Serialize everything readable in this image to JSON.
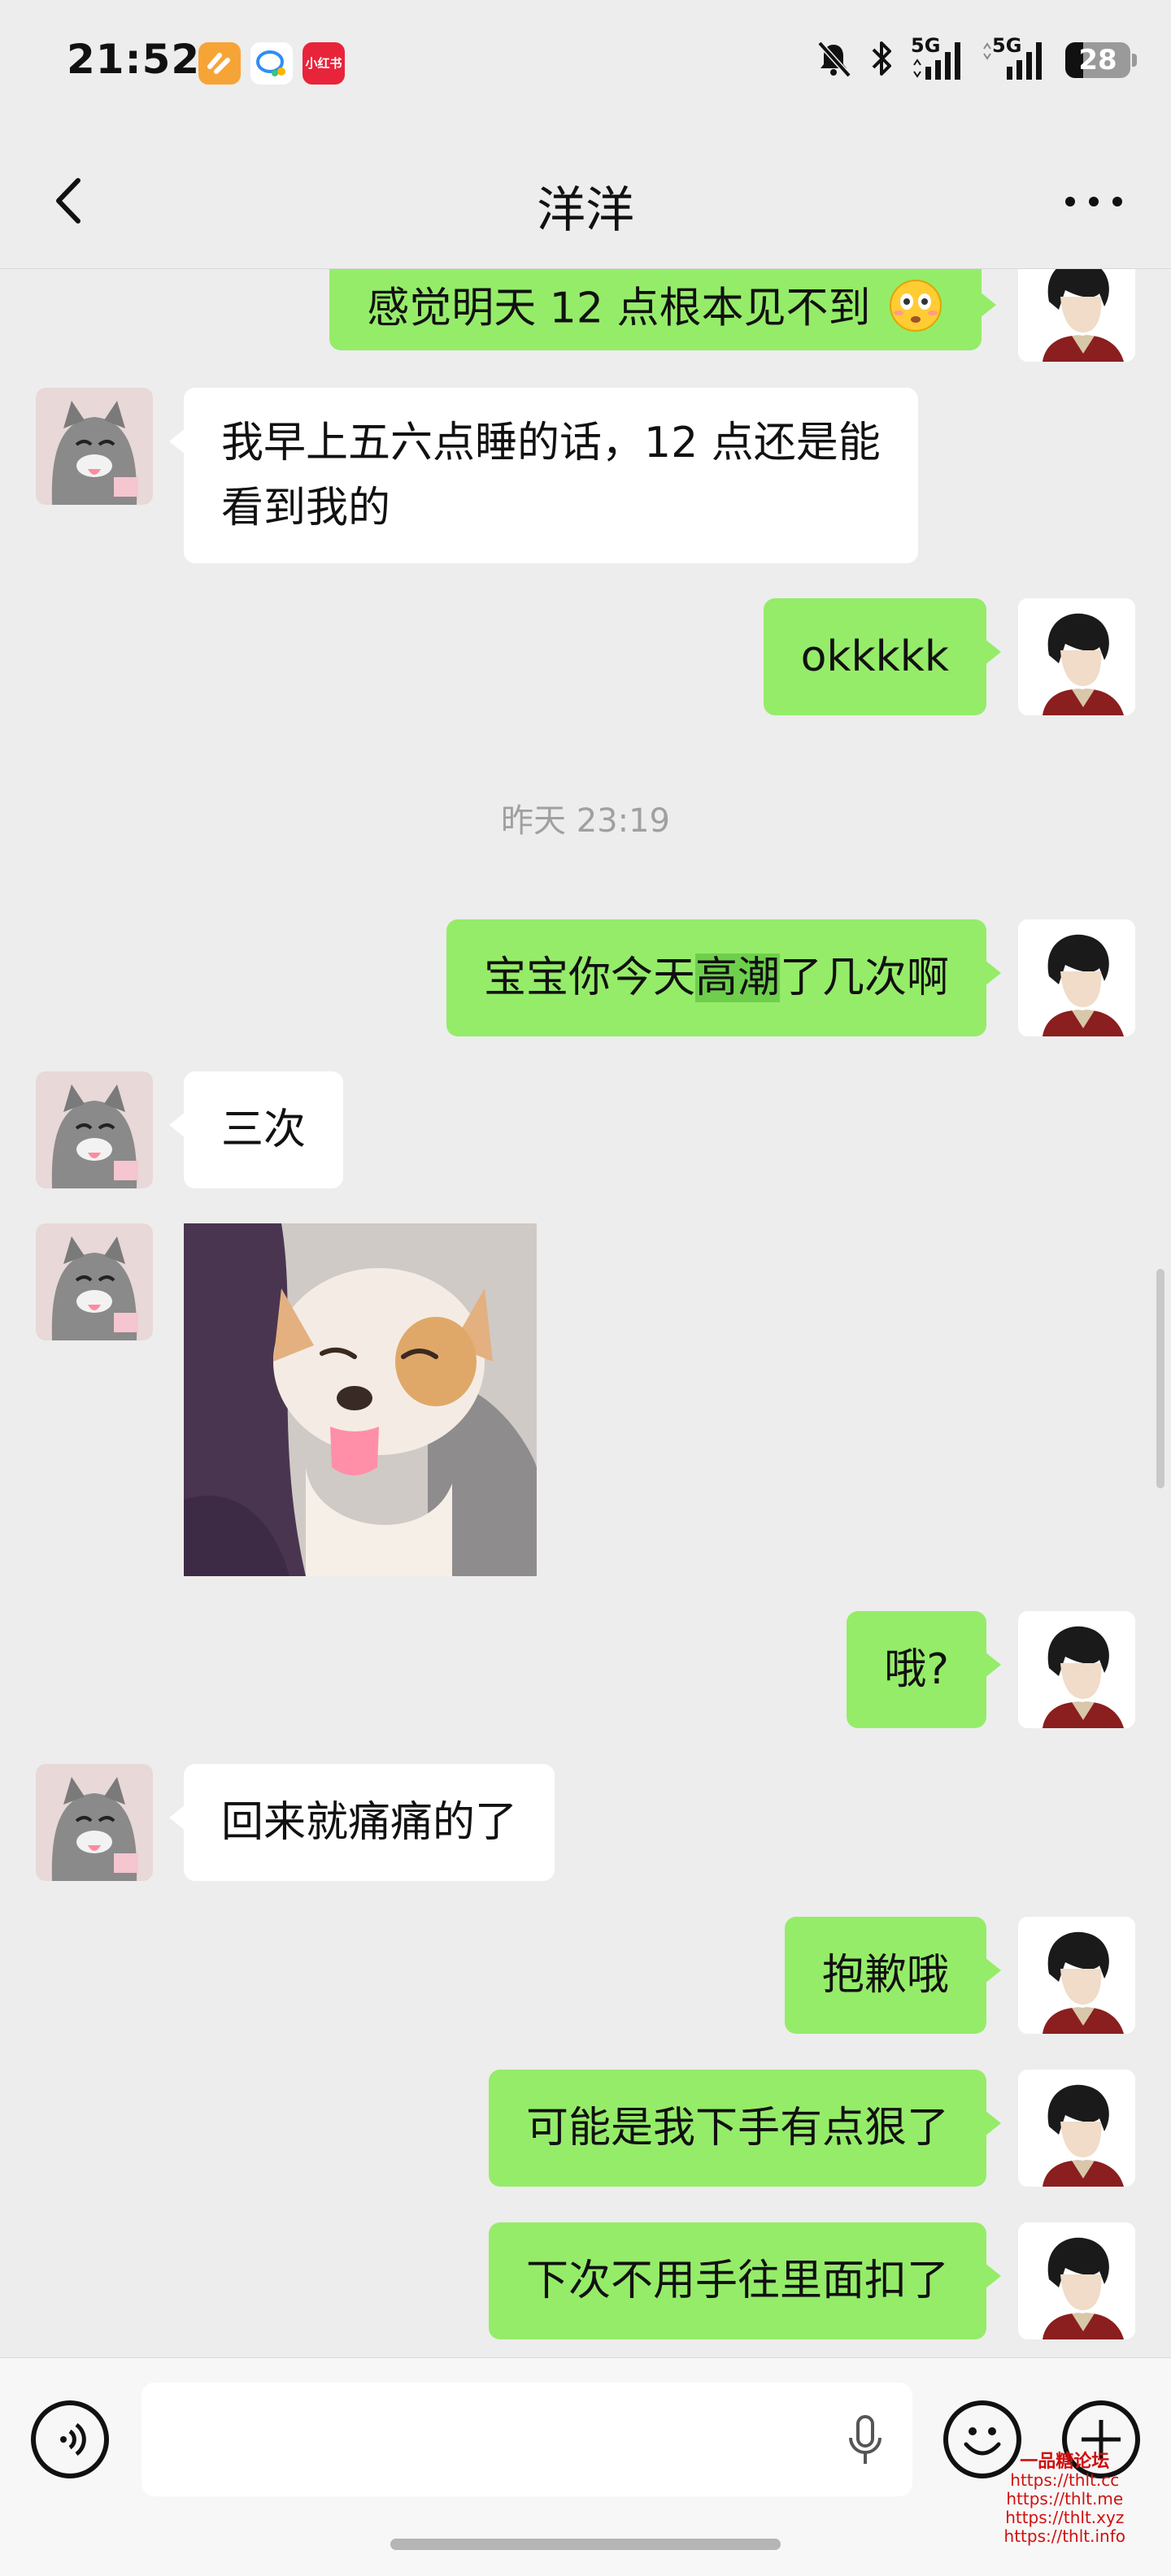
{
  "status_bar": {
    "time": "21:52",
    "apps": [
      "pay-app-icon",
      "chat-app-icon",
      "xiaohongshu-icon"
    ],
    "xiaohongshu_label": "小红书",
    "network_1": "5G",
    "network_2": "5G",
    "battery": "28",
    "battery_level": 0.28
  },
  "header": {
    "title": "洋洋"
  },
  "timestamp": "昨天 23:19",
  "messages": [
    {
      "side": "me",
      "text": "感觉明天 12 点根本见不到"
    },
    {
      "side": "other",
      "line1": "我早上五六点睡的话，12 点还是能",
      "line2": "看到我的"
    },
    {
      "side": "me",
      "text": "okkkkk"
    },
    {
      "side": "me",
      "pre": "宝宝你今天",
      "hl": "高潮",
      "post": "了几次啊"
    },
    {
      "side": "other",
      "text": "三次"
    },
    {
      "side": "other",
      "type": "image",
      "content": "dog-sticker"
    },
    {
      "side": "me",
      "text": "哦?"
    },
    {
      "side": "other",
      "text": "回来就痛痛的了"
    },
    {
      "side": "me",
      "text": "抱歉哦"
    },
    {
      "side": "me",
      "text": "可能是我下手有点狠了"
    },
    {
      "side": "me",
      "text": "下次不用手往里面扣了"
    }
  ],
  "watermark": {
    "title": "一品糖论坛",
    "lines": [
      "https://thlt.cc",
      "https://thlt.me",
      "https://thlt.xyz",
      "https://thlt.info"
    ]
  },
  "colors": {
    "my_bubble": "#95ec69",
    "other_bubble": "#ffffff",
    "background": "#ededed"
  }
}
